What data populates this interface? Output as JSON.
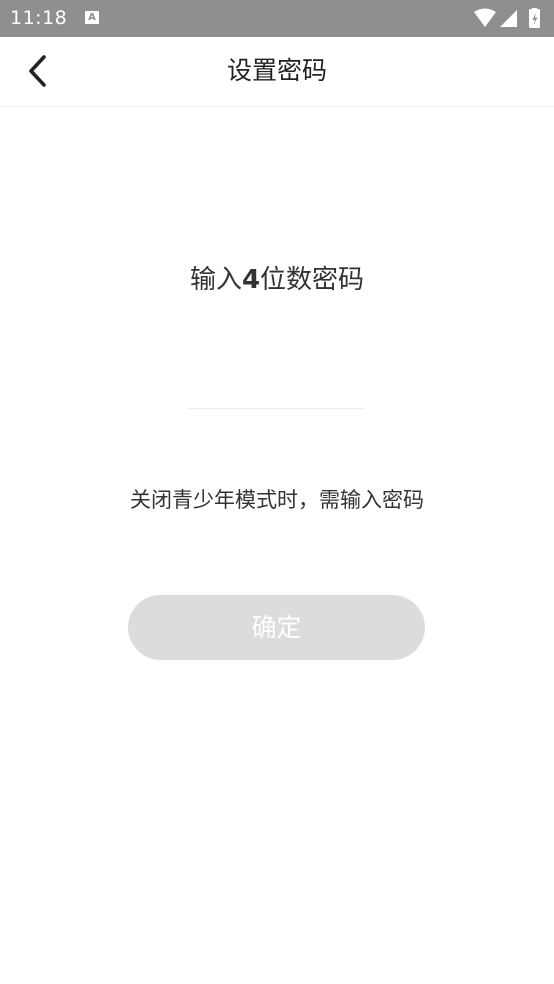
{
  "status_bar": {
    "time": "11:18",
    "notification_icon": "a-notification-icon",
    "notification_glyph": "A",
    "icons": [
      "wifi-icon",
      "signal-icon",
      "battery-charging-icon"
    ]
  },
  "app_bar": {
    "back_icon": "chevron-left-icon",
    "title": "设置密码"
  },
  "main": {
    "prompt_prefix": "输入",
    "prompt_number": "4",
    "prompt_suffix": "位数密码",
    "pin_value": "",
    "hint": "关闭青少年模式时，需输入密码",
    "confirm_label": "确定"
  },
  "colors": {
    "status_bar_bg": "#8f8f8f",
    "button_disabled_bg": "#dcdcdc",
    "text_primary": "#222222"
  }
}
